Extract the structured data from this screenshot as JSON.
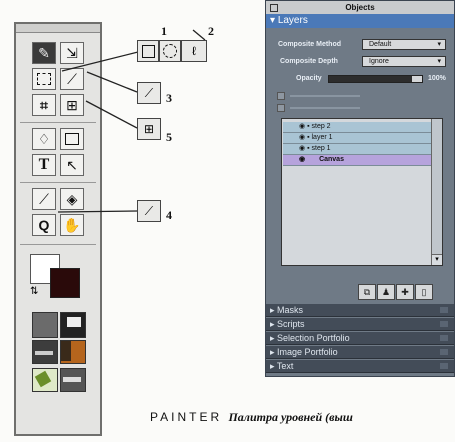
{
  "callouts": {
    "n1": "1",
    "n2": "2",
    "n3": "3",
    "n4": "4",
    "n5": "5"
  },
  "objects_palette": {
    "title": "Objects",
    "layers_section": {
      "header": "Layers",
      "composite_method_label": "Composite Method",
      "composite_method_value": "Default",
      "composite_depth_label": "Composite Depth",
      "composite_depth_value": "Ignore",
      "opacity_label": "Opacity",
      "opacity_value": "100%",
      "layers": [
        {
          "name": "step 2"
        },
        {
          "name": "layer 1"
        },
        {
          "name": "step 1"
        },
        {
          "name": "Canvas"
        }
      ]
    },
    "sections": [
      {
        "label": "Masks"
      },
      {
        "label": "Scripts"
      },
      {
        "label": "Selection Portfolio"
      },
      {
        "label": "Image Portfolio"
      },
      {
        "label": "Text"
      }
    ]
  },
  "caption": {
    "prefix": "PAINTER ",
    "text": "Палитра   уровней   (выш"
  },
  "colors": {
    "layers_header": "#4b79b8",
    "palette_bg": "#6f7a86",
    "canvas_row": "#b6a3dc"
  }
}
